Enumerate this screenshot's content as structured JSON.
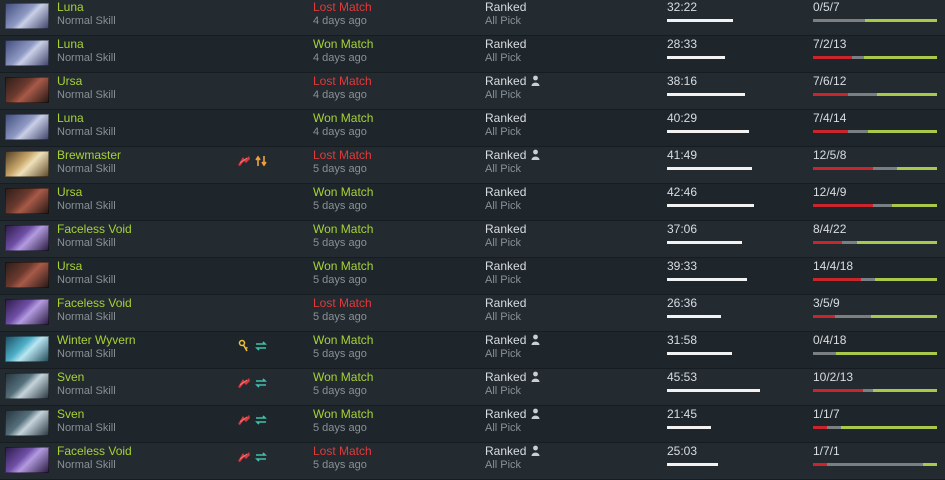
{
  "colors": {
    "won": "#a6d236",
    "lost": "#e03b3b",
    "kills": "#c8252c",
    "deaths": "#7a7f83",
    "assists": "#a8c94a"
  },
  "duration_scale_max": "45:53",
  "matches": [
    {
      "hero": "Luna",
      "portrait": "luna-portrait",
      "skill": "Normal Skill",
      "items": [],
      "result": "Lost Match",
      "outcome": "lost",
      "ago": "4 days ago",
      "lobby": "Ranked",
      "party": false,
      "mode": "All Pick",
      "duration": "32:22",
      "kda": "0/5/7",
      "k": 0,
      "d": 5,
      "a": 7
    },
    {
      "hero": "Luna",
      "portrait": "luna-portrait",
      "skill": "Normal Skill",
      "items": [],
      "result": "Won Match",
      "outcome": "won",
      "ago": "4 days ago",
      "lobby": "Ranked",
      "party": false,
      "mode": "All Pick",
      "duration": "28:33",
      "kda": "7/2/13",
      "k": 7,
      "d": 2,
      "a": 13
    },
    {
      "hero": "Ursa",
      "portrait": "ursa-portrait",
      "skill": "Normal Skill",
      "items": [],
      "result": "Lost Match",
      "outcome": "lost",
      "ago": "4 days ago",
      "lobby": "Ranked",
      "party": true,
      "mode": "All Pick",
      "duration": "38:16",
      "kda": "7/6/12",
      "k": 7,
      "d": 6,
      "a": 12
    },
    {
      "hero": "Luna",
      "portrait": "luna-portrait",
      "skill": "Normal Skill",
      "items": [],
      "result": "Won Match",
      "outcome": "won",
      "ago": "4 days ago",
      "lobby": "Ranked",
      "party": false,
      "mode": "All Pick",
      "duration": "40:29",
      "kda": "7/4/14",
      "k": 7,
      "d": 4,
      "a": 14
    },
    {
      "hero": "Brewmaster",
      "portrait": "brewmaster-portrait",
      "skill": "Normal Skill",
      "items": [
        "wings-icon",
        "swap-arrows-icon"
      ],
      "result": "Lost Match",
      "outcome": "lost",
      "ago": "5 days ago",
      "lobby": "Ranked",
      "party": true,
      "mode": "All Pick",
      "duration": "41:49",
      "kda": "12/5/8",
      "k": 12,
      "d": 5,
      "a": 8
    },
    {
      "hero": "Ursa",
      "portrait": "ursa-portrait",
      "skill": "Normal Skill",
      "items": [],
      "result": "Won Match",
      "outcome": "won",
      "ago": "5 days ago",
      "lobby": "Ranked",
      "party": false,
      "mode": "All Pick",
      "duration": "42:46",
      "kda": "12/4/9",
      "k": 12,
      "d": 4,
      "a": 9
    },
    {
      "hero": "Faceless Void",
      "portrait": "faceless-void-portrait",
      "skill": "Normal Skill",
      "items": [],
      "result": "Won Match",
      "outcome": "won",
      "ago": "5 days ago",
      "lobby": "Ranked",
      "party": false,
      "mode": "All Pick",
      "duration": "37:06",
      "kda": "8/4/22",
      "k": 8,
      "d": 4,
      "a": 22
    },
    {
      "hero": "Ursa",
      "portrait": "ursa-portrait",
      "skill": "Normal Skill",
      "items": [],
      "result": "Won Match",
      "outcome": "won",
      "ago": "5 days ago",
      "lobby": "Ranked",
      "party": false,
      "mode": "All Pick",
      "duration": "39:33",
      "kda": "14/4/18",
      "k": 14,
      "d": 4,
      "a": 18
    },
    {
      "hero": "Faceless Void",
      "portrait": "faceless-void-portrait",
      "skill": "Normal Skill",
      "items": [],
      "result": "Lost Match",
      "outcome": "lost",
      "ago": "5 days ago",
      "lobby": "Ranked",
      "party": false,
      "mode": "All Pick",
      "duration": "26:36",
      "kda": "3/5/9",
      "k": 3,
      "d": 5,
      "a": 9
    },
    {
      "hero": "Winter Wyvern",
      "portrait": "winter-wyvern-portrait",
      "skill": "Normal Skill",
      "items": [
        "key-icon",
        "rotate-arrows-icon"
      ],
      "result": "Won Match",
      "outcome": "won",
      "ago": "5 days ago",
      "lobby": "Ranked",
      "party": true,
      "mode": "All Pick",
      "duration": "31:58",
      "kda": "0/4/18",
      "k": 0,
      "d": 4,
      "a": 18
    },
    {
      "hero": "Sven",
      "portrait": "sven-portrait",
      "skill": "Normal Skill",
      "items": [
        "wings-icon",
        "rotate-arrows-icon"
      ],
      "result": "Won Match",
      "outcome": "won",
      "ago": "5 days ago",
      "lobby": "Ranked",
      "party": true,
      "mode": "All Pick",
      "duration": "45:53",
      "kda": "10/2/13",
      "k": 10,
      "d": 2,
      "a": 13
    },
    {
      "hero": "Sven",
      "portrait": "sven-portrait",
      "skill": "Normal Skill",
      "items": [
        "wings-icon",
        "rotate-arrows-icon"
      ],
      "result": "Won Match",
      "outcome": "won",
      "ago": "5 days ago",
      "lobby": "Ranked",
      "party": true,
      "mode": "All Pick",
      "duration": "21:45",
      "kda": "1/1/7",
      "k": 1,
      "d": 1,
      "a": 7
    },
    {
      "hero": "Faceless Void",
      "portrait": "faceless-void-portrait",
      "skill": "Normal Skill",
      "items": [
        "wings-icon",
        "rotate-arrows-icon"
      ],
      "result": "Lost Match",
      "outcome": "lost",
      "ago": "5 days ago",
      "lobby": "Ranked",
      "party": true,
      "mode": "All Pick",
      "duration": "25:03",
      "kda": "1/7/1",
      "k": 1,
      "d": 7,
      "a": 1
    }
  ]
}
